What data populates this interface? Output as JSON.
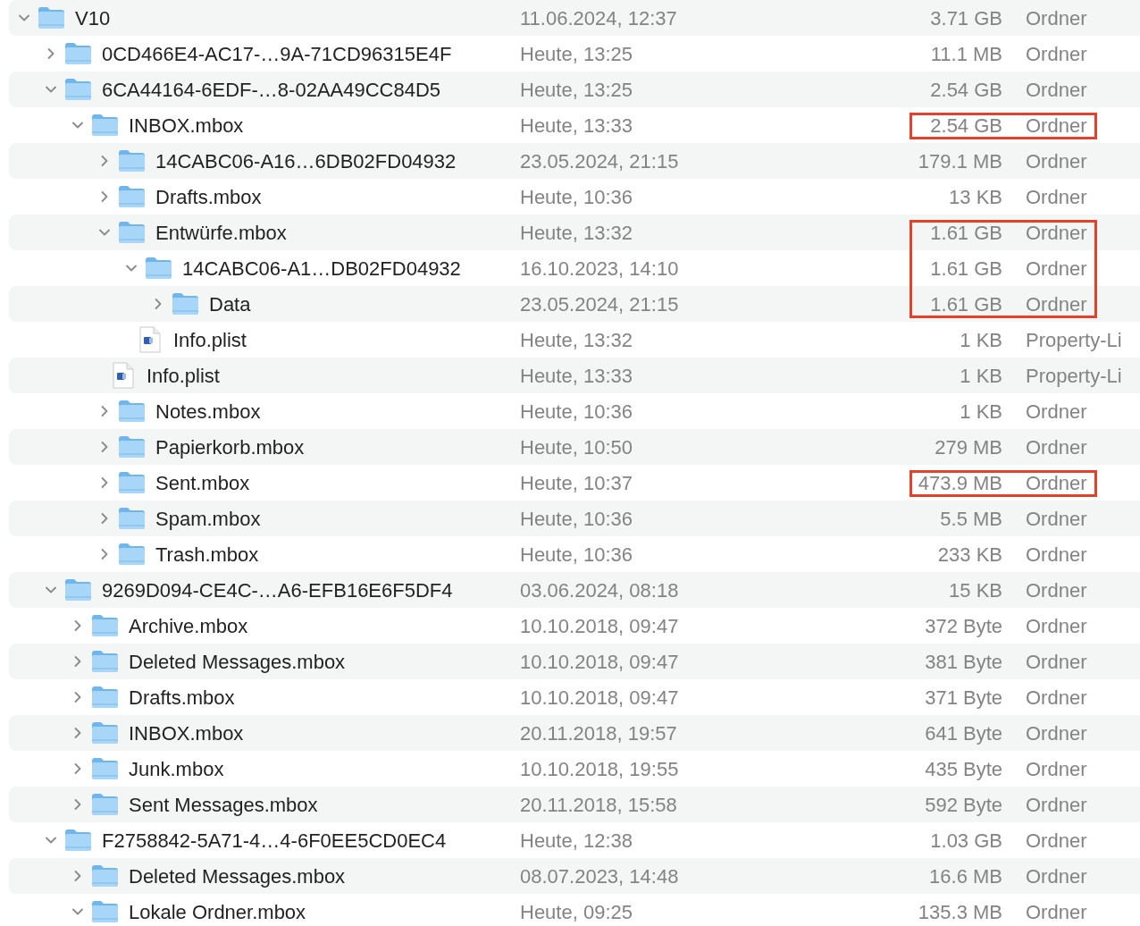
{
  "items": [
    {
      "kind": "folder",
      "name": "V10",
      "date": "11.06.2024, 12:37",
      "size": "3.71 GB",
      "type": "Ordner",
      "expanded": true,
      "highlighted": false,
      "children": [
        {
          "kind": "folder",
          "name": "0CD466E4-AC17-…9A-71CD96315E4F",
          "date": "Heute, 13:25",
          "size": "11.1 MB",
          "type": "Ordner",
          "expanded": false,
          "highlighted": false
        },
        {
          "kind": "folder",
          "name": "6CA44164-6EDF-…8-02AA49CC84D5",
          "date": "Heute, 13:25",
          "size": "2.54 GB",
          "type": "Ordner",
          "expanded": true,
          "highlighted": false,
          "children": [
            {
              "kind": "folder",
              "name": "INBOX.mbox",
              "date": "Heute, 13:33",
              "size": "2.54 GB",
              "type": "Ordner",
              "expanded": true,
              "highlighted": true,
              "children": [
                {
                  "kind": "folder",
                  "name": "14CABC06-A16…6DB02FD04932",
                  "date": "23.05.2024, 21:15",
                  "size": "179.1 MB",
                  "type": "Ordner",
                  "expanded": false,
                  "highlighted": false
                },
                {
                  "kind": "folder",
                  "name": "Drafts.mbox",
                  "date": "Heute, 10:36",
                  "size": "13 KB",
                  "type": "Ordner",
                  "expanded": false,
                  "highlighted": false
                },
                {
                  "kind": "folder",
                  "name": "Entwürfe.mbox",
                  "date": "Heute, 13:32",
                  "size": "1.61 GB",
                  "type": "Ordner",
                  "expanded": true,
                  "highlighted": true,
                  "children": [
                    {
                      "kind": "folder",
                      "name": "14CABC06-A1…DB02FD04932",
                      "date": "16.10.2023, 14:10",
                      "size": "1.61 GB",
                      "type": "Ordner",
                      "expanded": true,
                      "highlighted": true,
                      "children": [
                        {
                          "kind": "folder",
                          "name": "Data",
                          "date": "23.05.2024, 21:15",
                          "size": "1.61 GB",
                          "type": "Ordner",
                          "expanded": false,
                          "highlighted": true
                        }
                      ]
                    },
                    {
                      "kind": "file",
                      "name": "Info.plist",
                      "date": "Heute, 13:32",
                      "size": "1 KB",
                      "type": "Property-Li",
                      "highlighted": false
                    }
                  ]
                },
                {
                  "kind": "file",
                  "name": "Info.plist",
                  "date": "Heute, 13:33",
                  "size": "1 KB",
                  "type": "Property-Li",
                  "highlighted": false
                },
                {
                  "kind": "folder",
                  "name": "Notes.mbox",
                  "date": "Heute, 10:36",
                  "size": "1 KB",
                  "type": "Ordner",
                  "expanded": false,
                  "highlighted": false
                },
                {
                  "kind": "folder",
                  "name": "Papierkorb.mbox",
                  "date": "Heute, 10:50",
                  "size": "279 MB",
                  "type": "Ordner",
                  "expanded": false,
                  "highlighted": false
                },
                {
                  "kind": "folder",
                  "name": "Sent.mbox",
                  "date": "Heute, 10:37",
                  "size": "473.9 MB",
                  "type": "Ordner",
                  "expanded": false,
                  "highlighted": true
                },
                {
                  "kind": "folder",
                  "name": "Spam.mbox",
                  "date": "Heute, 10:36",
                  "size": "5.5 MB",
                  "type": "Ordner",
                  "expanded": false,
                  "highlighted": false
                },
                {
                  "kind": "folder",
                  "name": "Trash.mbox",
                  "date": "Heute, 10:36",
                  "size": "233 KB",
                  "type": "Ordner",
                  "expanded": false,
                  "highlighted": false
                }
              ]
            }
          ]
        },
        {
          "kind": "folder",
          "name": "9269D094-CE4C-…A6-EFB16E6F5DF4",
          "date": "03.06.2024, 08:18",
          "size": "15 KB",
          "type": "Ordner",
          "expanded": true,
          "highlighted": false,
          "children": [
            {
              "kind": "folder",
              "name": "Archive.mbox",
              "date": "10.10.2018, 09:47",
              "size": "372 Byte",
              "type": "Ordner",
              "expanded": false,
              "highlighted": false
            },
            {
              "kind": "folder",
              "name": "Deleted Messages.mbox",
              "date": "10.10.2018, 09:47",
              "size": "381 Byte",
              "type": "Ordner",
              "expanded": false,
              "highlighted": false
            },
            {
              "kind": "folder",
              "name": "Drafts.mbox",
              "date": "10.10.2018, 09:47",
              "size": "371 Byte",
              "type": "Ordner",
              "expanded": false,
              "highlighted": false
            },
            {
              "kind": "folder",
              "name": "INBOX.mbox",
              "date": "20.11.2018, 19:57",
              "size": "641 Byte",
              "type": "Ordner",
              "expanded": false,
              "highlighted": false
            },
            {
              "kind": "folder",
              "name": "Junk.mbox",
              "date": "10.10.2018, 19:55",
              "size": "435 Byte",
              "type": "Ordner",
              "expanded": false,
              "highlighted": false
            },
            {
              "kind": "folder",
              "name": "Sent Messages.mbox",
              "date": "20.11.2018, 15:58",
              "size": "592 Byte",
              "type": "Ordner",
              "expanded": false,
              "highlighted": false
            }
          ]
        },
        {
          "kind": "folder",
          "name": "F2758842-5A71-4…4-6F0EE5CD0EC4",
          "date": "Heute, 12:38",
          "size": "1.03 GB",
          "type": "Ordner",
          "expanded": true,
          "highlighted": false,
          "children": [
            {
              "kind": "folder",
              "name": "Deleted Messages.mbox",
              "date": "08.07.2023, 14:48",
              "size": "16.6 MB",
              "type": "Ordner",
              "expanded": false,
              "highlighted": false
            },
            {
              "kind": "folder",
              "name": "Lokale Ordner.mbox",
              "date": "Heute, 09:25",
              "size": "135.3 MB",
              "type": "Ordner",
              "expanded": true,
              "highlighted": false
            }
          ]
        }
      ]
    }
  ]
}
